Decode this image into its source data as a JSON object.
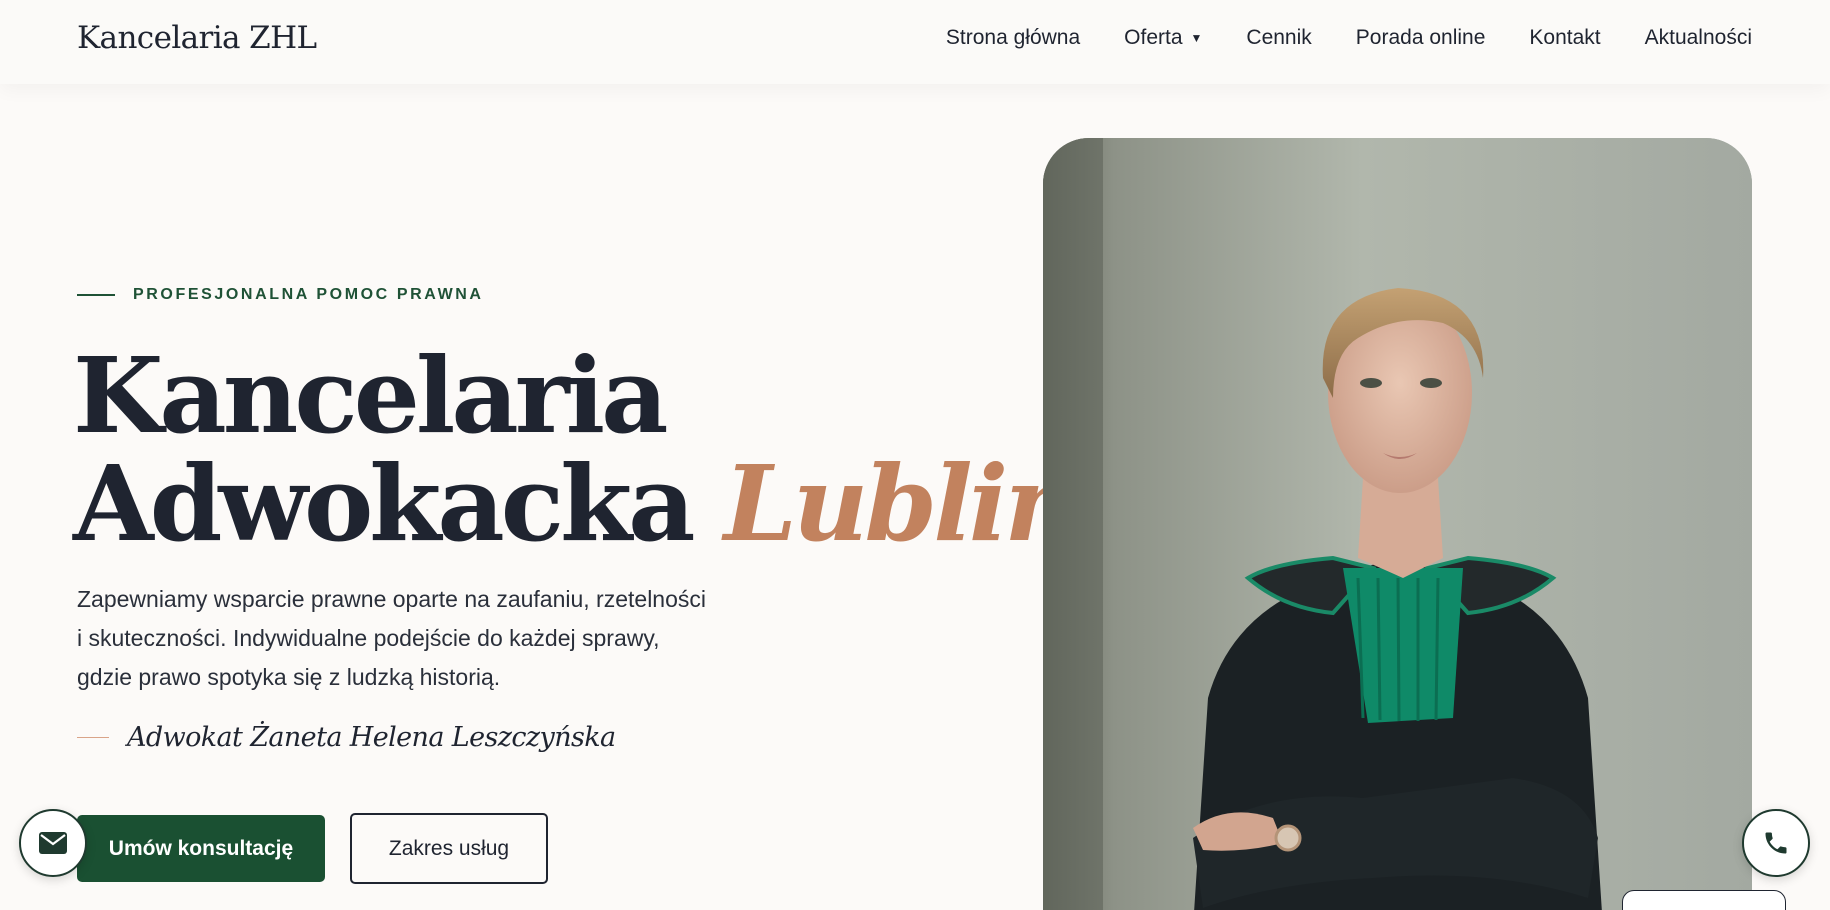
{
  "header": {
    "logo": "Kancelaria ZHL",
    "nav": [
      {
        "label": "Strona główna"
      },
      {
        "label": "Oferta",
        "has_dropdown": true
      },
      {
        "label": "Cennik"
      },
      {
        "label": "Porada online"
      },
      {
        "label": "Kontakt"
      },
      {
        "label": "Aktualności"
      }
    ]
  },
  "hero": {
    "eyebrow": "PROFESJONALNA POMOC PRAWNA",
    "headline_line1": "Kancelaria",
    "headline_line2": "Adwokacka",
    "headline_accent": "Lublin",
    "lead_line1": "Zapewniamy wsparcie prawne oparte na zaufaniu, rzetelności",
    "lead_line2": "i skuteczności. Indywidualne podejście do każdej sprawy,",
    "lead_line3": "gdzie prawo spotyka się z ludzką historią.",
    "signature": "Adwokat Żaneta Helena Leszczyńska",
    "primary_cta": "Umów konsultację",
    "secondary_cta": "Zakres usług"
  },
  "floating": {
    "mail_icon": "mail-icon",
    "phone_icon": "phone-icon"
  },
  "colors": {
    "accent_green": "#1a5032",
    "accent_copper": "#c2825e",
    "text_dark": "#1f2430",
    "background": "#fcfaf8"
  }
}
